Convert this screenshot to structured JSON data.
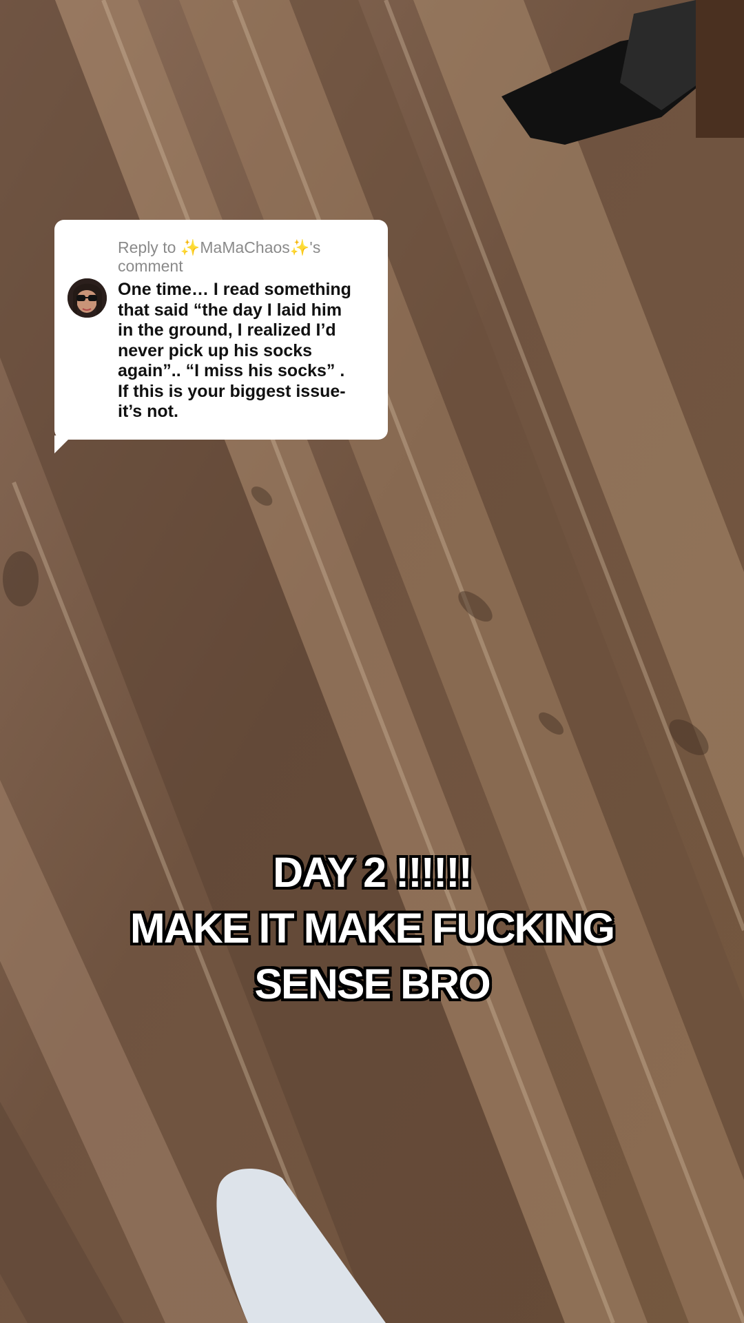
{
  "reply": {
    "header": "Reply to ✨MaMaChaos✨'s comment",
    "body_lines": [
      "One time… I read something",
      "that said “the day I laid him",
      "in the ground, I realized I’d",
      "never pick up his socks",
      "again”.. “I miss his socks” .",
      "If this is your biggest issue-",
      "it’s not."
    ]
  },
  "caption": {
    "lines": [
      "DAY 2 !!!!!!",
      "MAKE IT MAKE FUCKING",
      "SENSE BRO"
    ]
  },
  "scene": {
    "icons": {
      "avatar": "commenter-avatar-icon"
    },
    "colors": {
      "card_bg": "#ffffff",
      "header_text": "#8a8a8a",
      "body_text": "#111111",
      "caption_fill": "#ffffff",
      "caption_stroke": "#000000"
    }
  }
}
